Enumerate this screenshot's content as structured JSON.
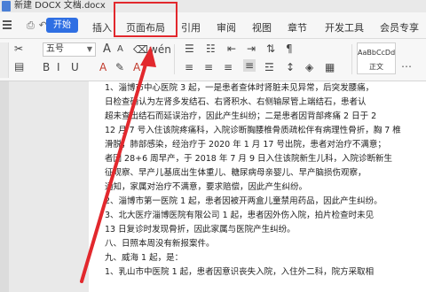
{
  "window": {
    "title": "新建 DOCX 文档.docx",
    "close_glyph": "×"
  },
  "tabs": {
    "start": "开始",
    "insert": "插入",
    "page_layout": "页面布局",
    "reference": "引用",
    "review": "审阅",
    "view": "视图",
    "section": "章节",
    "dev_tools": "开发工具",
    "member": "会员专享"
  },
  "ribbon": {
    "font_size": "五号",
    "style_sample": "AaBbCcDd",
    "style_name": "正文"
  },
  "document": {
    "lines": [
      "1、淄博市中心医院 3 起，一是患者查体时肾脏未见异常，后突发腰痛，",
      "日检查确认为左肾多发结石、右肾积水、右侧输尿管上端结石，患者认",
      "超未查出结石而延误治疗，因此产生纠纷；二是患者因背部疼痛 2 日于 2",
      "12 月 7 号入住该院疼痛科，入院诊断胸腰椎骨质疏松伴有病理性骨折，胸 7 椎",
      "滑脱，肺部感染，经治疗于 2020 年 1 月 17 号出院，患者对治疗不满意；",
      "者因 28+6 周早产，于 2018 年 7 月 9 日入住该院新生儿科，入院诊断新生",
      "征观察、早产儿基底出生体重儿、糖尿病母亲婴儿、早产脑损伤观察，",
      "通知，家属对治疗不满意，要求赔偿，因此产生纠纷。",
      "2、淄博市第一医院 1 起，患者因被开两盒儿童禁用药品，因此产生纠纷。",
      "3、北大医疗淄博医院有限公司 1 起，患者因外伤入院，拍片检查时未见",
      "13 日复诊时发现骨折，因此家属与医院产生纠纷。",
      "八、日照本周没有新报案件。",
      "九、威海 1 起，是：",
      "1、乳山市中医院 1 起，患者因意识丧失入院，入住外二科，院方采取相"
    ]
  }
}
